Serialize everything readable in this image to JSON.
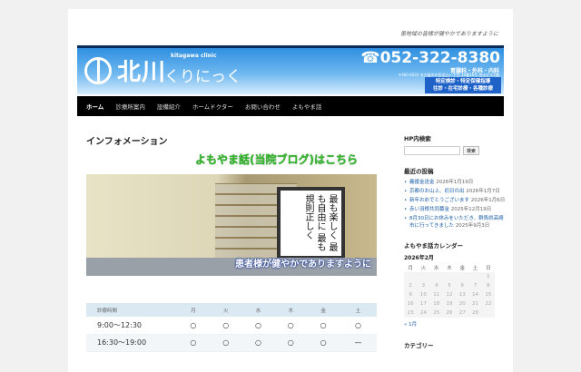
{
  "header": {
    "tagline": "患地域の皆様が健やかでありますように",
    "logo_name": "北川",
    "logo_kana": "くりにっく",
    "logo_en": "kitagawa clinic",
    "phone": "☎052-322-8380",
    "departments": "胃腸科・外科・内科",
    "address": "〒460-0022 名古屋市中区金山一丁目 16番16号 金山ビル1階",
    "services": [
      "特定検診・特定保健指導",
      "往診・在宅診療・各種診療"
    ]
  },
  "nav": [
    "ホーム",
    "診療所案内",
    "設備紹介",
    "ホームドクター",
    "お問い合わせ",
    "よもやま話"
  ],
  "main": {
    "title": "インフォメーション",
    "blog_link": "よもやま話(当院ブログ)はこちら",
    "photo_caption": "患者様が健やかでありますように",
    "scroll_text": "最も楽しく 最も自由に 最も規則正しく",
    "hours": {
      "headers": [
        "診療時間",
        "月",
        "火",
        "水",
        "木",
        "金",
        "土"
      ],
      "rows": [
        [
          "9:00〜12:30",
          "○",
          "○",
          "○",
          "○",
          "○",
          "○"
        ],
        [
          "16:30〜19:00",
          "○",
          "○",
          "○",
          "○",
          "○",
          "—"
        ]
      ]
    }
  },
  "sidebar": {
    "search_title": "HP内検索",
    "search_placeholder": "",
    "search_button": "検索",
    "recent_title": "最近の投稿",
    "posts": [
      {
        "title": "義援金送金",
        "date": "2026年1月19日"
      },
      {
        "title": "京都のお山上、初日の出",
        "date": "2026年1月7日"
      },
      {
        "title": "新年おめでとうございます",
        "date": "2026年1月6日"
      },
      {
        "title": "赤い羽根共同募金",
        "date": "2025年12月19日"
      },
      {
        "title": "8月30日にお休みをいただき、群馬県高崎市に行ってきました",
        "date": "2025年9月3日"
      }
    ],
    "calendar_title": "よもやま話カレンダー",
    "calendar_month": "2026年2月",
    "weekdays": [
      "月",
      "火",
      "水",
      "木",
      "金",
      "土",
      "日"
    ],
    "weeks": [
      [
        "",
        "",
        "",
        "",
        "",
        "",
        "1"
      ],
      [
        "2",
        "3",
        "4",
        "5",
        "6",
        "7",
        "8"
      ],
      [
        "9",
        "10",
        "11",
        "12",
        "13",
        "14",
        "15"
      ],
      [
        "16",
        "17",
        "18",
        "19",
        "20",
        "21",
        "22"
      ],
      [
        "23",
        "24",
        "25",
        "26",
        "27",
        "28",
        ""
      ]
    ],
    "prev_month": "« 1月",
    "category_title": "カテゴリー"
  }
}
